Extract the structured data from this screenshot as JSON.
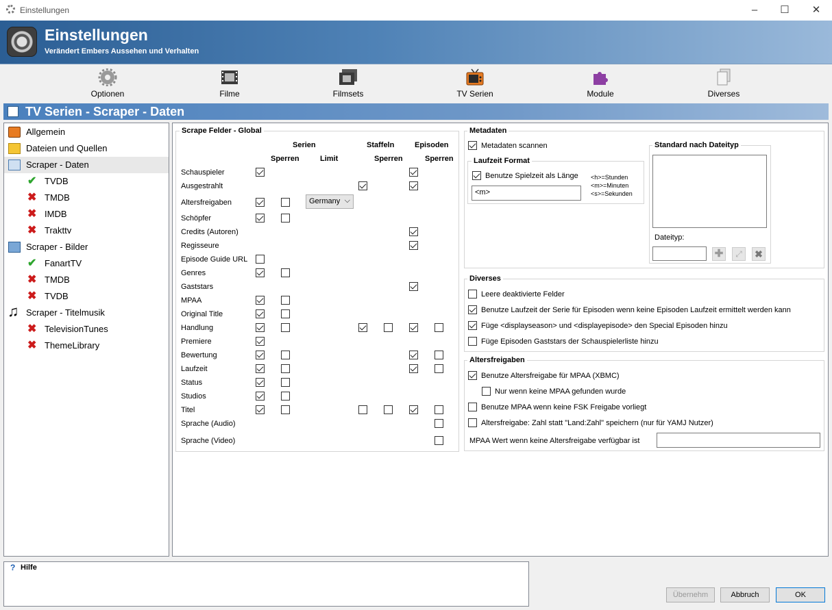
{
  "window": {
    "title": "Einstellungen"
  },
  "header": {
    "title": "Einstellungen",
    "subtitle": "Verändert Embers Aussehen und Verhalten"
  },
  "toolbar": [
    {
      "label": "Optionen",
      "icon": "gear-icon"
    },
    {
      "label": "Filme",
      "icon": "film-icon"
    },
    {
      "label": "Filmsets",
      "icon": "filmsets-icon"
    },
    {
      "label": "TV Serien",
      "icon": "tv-icon"
    },
    {
      "label": "Module",
      "icon": "puzzle-icon"
    },
    {
      "label": "Diverses",
      "icon": "documents-icon"
    }
  ],
  "section_title": "TV Serien - Scraper - Daten",
  "tree": [
    {
      "label": "Allgemein",
      "icon": "tv-icon"
    },
    {
      "label": "Dateien und Quellen",
      "icon": "folder-icon"
    },
    {
      "label": "Scraper - Daten",
      "icon": "scraper-data-icon",
      "selected": true
    },
    {
      "label": "TVDB",
      "icon": "enabled-check-icon"
    },
    {
      "label": "TMDB",
      "icon": "disabled-x-icon"
    },
    {
      "label": "IMDB",
      "icon": "disabled-x-icon"
    },
    {
      "label": "Trakttv",
      "icon": "disabled-x-icon"
    },
    {
      "label": "Scraper - Bilder",
      "icon": "scraper-images-icon"
    },
    {
      "label": "FanartTV",
      "icon": "enabled-check-icon"
    },
    {
      "label": "TMDB",
      "icon": "disabled-x-icon"
    },
    {
      "label": "TVDB",
      "icon": "disabled-x-icon"
    },
    {
      "label": "Scraper - Titelmusik",
      "icon": "music-note-icon"
    },
    {
      "label": "TelevisionTunes",
      "icon": "disabled-x-icon"
    },
    {
      "label": "ThemeLibrary",
      "icon": "disabled-x-icon"
    }
  ],
  "scrape_fields": {
    "title": "Scrape Felder - Global",
    "col_serien": "Serien",
    "col_staffeln": "Staffeln",
    "col_episoden": "Episoden",
    "sub_sperren": "Sperren",
    "sub_limit": "Limit",
    "limit_value": "Germany",
    "rows": [
      {
        "label": "Schauspieler",
        "s": true,
        "sl": null,
        "st": null,
        "stl": null,
        "e": true,
        "el": null
      },
      {
        "label": "Ausgestrahlt",
        "s": null,
        "sl": null,
        "st": true,
        "stl": null,
        "e": true,
        "el": null
      },
      {
        "label": "Altersfreigaben",
        "s": true,
        "sl": false,
        "st": null,
        "stl": null,
        "e": null,
        "el": null,
        "limit": true
      },
      {
        "label": "Schöpfer",
        "s": true,
        "sl": false,
        "st": null,
        "stl": null,
        "e": null,
        "el": null
      },
      {
        "label": "Credits (Autoren)",
        "s": null,
        "sl": null,
        "st": null,
        "stl": null,
        "e": true,
        "el": null
      },
      {
        "label": "Regisseure",
        "s": null,
        "sl": null,
        "st": null,
        "stl": null,
        "e": true,
        "el": null
      },
      {
        "label": "Episode Guide URL",
        "s": false,
        "sl": null,
        "st": null,
        "stl": null,
        "e": null,
        "el": null
      },
      {
        "label": "Genres",
        "s": true,
        "sl": false,
        "st": null,
        "stl": null,
        "e": null,
        "el": null
      },
      {
        "label": "Gaststars",
        "s": null,
        "sl": null,
        "st": null,
        "stl": null,
        "e": true,
        "el": null
      },
      {
        "label": "MPAA",
        "s": true,
        "sl": false,
        "st": null,
        "stl": null,
        "e": null,
        "el": null
      },
      {
        "label": "Original Title",
        "s": true,
        "sl": false,
        "st": null,
        "stl": null,
        "e": null,
        "el": null
      },
      {
        "label": "Handlung",
        "s": true,
        "sl": false,
        "st": true,
        "stl": false,
        "e": true,
        "el": false
      },
      {
        "label": "Premiere",
        "s": true,
        "sl": null,
        "st": null,
        "stl": null,
        "e": null,
        "el": null
      },
      {
        "label": "Bewertung",
        "s": true,
        "sl": false,
        "st": null,
        "stl": null,
        "e": true,
        "el": false
      },
      {
        "label": "Laufzeit",
        "s": true,
        "sl": false,
        "st": null,
        "stl": null,
        "e": true,
        "el": false
      },
      {
        "label": "Status",
        "s": true,
        "sl": false,
        "st": null,
        "stl": null,
        "e": null,
        "el": null
      },
      {
        "label": "Studios",
        "s": true,
        "sl": false,
        "st": null,
        "stl": null,
        "e": null,
        "el": null
      },
      {
        "label": "Titel",
        "s": true,
        "sl": false,
        "st": false,
        "stl": false,
        "e": true,
        "el": false
      },
      {
        "label": "Sprache (Audio)",
        "s": null,
        "sl": null,
        "st": null,
        "stl": null,
        "e": null,
        "el": false
      },
      {
        "label": "Sprache (Video)",
        "s": null,
        "sl": null,
        "st": null,
        "stl": null,
        "e": null,
        "el": false
      }
    ]
  },
  "metadaten": {
    "title": "Metadaten",
    "scan_label": "Metadaten scannen",
    "laufzeit_title": "Laufzeit Format",
    "spielzeit_label": "Benutze Spielzeit als Länge",
    "format_value": "<m>",
    "hint_h": "<h>=Stunden",
    "hint_m": "<m>=Minuten",
    "hint_s": "<s>=Sekunden",
    "standard_title": "Standard nach Dateityp",
    "dateityp_label": "Dateityp:"
  },
  "diverses": {
    "title": "Diverses",
    "options": [
      {
        "label": "Leere deaktivierte Felder",
        "checked": false
      },
      {
        "label": "Benutze Laufzeit der Serie für Episoden wenn keine Episoden Laufzeit ermittelt werden kann",
        "checked": true
      },
      {
        "label": "Füge <displayseason> und <displayepisode> den Special Episoden hinzu",
        "checked": true
      },
      {
        "label": "Füge Episoden Gaststars der Schauspielerliste hinzu",
        "checked": false
      }
    ]
  },
  "altersfreigaben": {
    "title": "Altersfreigaben",
    "options": [
      {
        "label": "Benutze Altersfreigabe für MPAA (XBMC)",
        "checked": true
      },
      {
        "label": "Nur wenn keine MPAA gefunden wurde",
        "checked": false
      },
      {
        "label": "Benutze MPAA wenn keine FSK Freigabe vorliegt",
        "checked": false
      },
      {
        "label": "Altersfreigabe: Zahl statt \"Land:Zahl\" speichern (nur für YAMJ Nutzer)",
        "checked": false
      }
    ],
    "mpaa_label": "MPAA Wert wenn keine Altersfreigabe verfügbar ist"
  },
  "help": {
    "title": "Hilfe"
  },
  "buttons": {
    "apply": "Übernehm",
    "cancel": "Abbruch",
    "ok": "OK"
  }
}
